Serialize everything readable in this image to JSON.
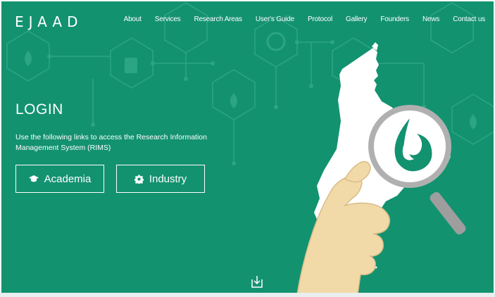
{
  "brand": {
    "logo": "EJAAD"
  },
  "nav": {
    "items": [
      "About",
      "Services",
      "Research Areas",
      "User's Guide",
      "Protocol",
      "Gallery",
      "Founders",
      "News",
      "Contact us"
    ]
  },
  "hero": {
    "title": "LOGIN",
    "description": "Use the following links to access the Research Information Management System (RIMS)",
    "buttons": [
      {
        "label": "Academia",
        "icon": "graduation-cap-icon"
      },
      {
        "label": "Industry",
        "icon": "gear-icon"
      }
    ]
  },
  "scroll": {
    "icon": "download-arrow-icon"
  },
  "colors": {
    "background": "#139270",
    "pattern": "#2aa381",
    "text": "#ffffff",
    "map": "#ffffff",
    "hand": "#f1d9a8",
    "magnifier": "#a9a9a9"
  }
}
